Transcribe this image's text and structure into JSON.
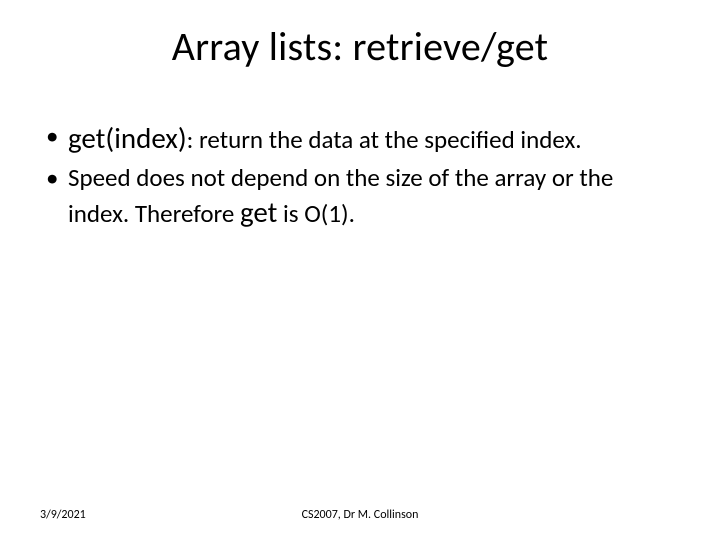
{
  "title": "Array lists: retrieve/get",
  "bullets": [
    {
      "lead": "get(index)",
      "rest": ": return the data at the specified index."
    },
    {
      "text_pre": "Speed does not depend on the size of the array or the index. Therefore ",
      "kw": "get",
      "text_post": " is O(1)."
    }
  ],
  "footer": {
    "date": "3/9/2021",
    "course": "CS2007, Dr M. Collinson"
  }
}
